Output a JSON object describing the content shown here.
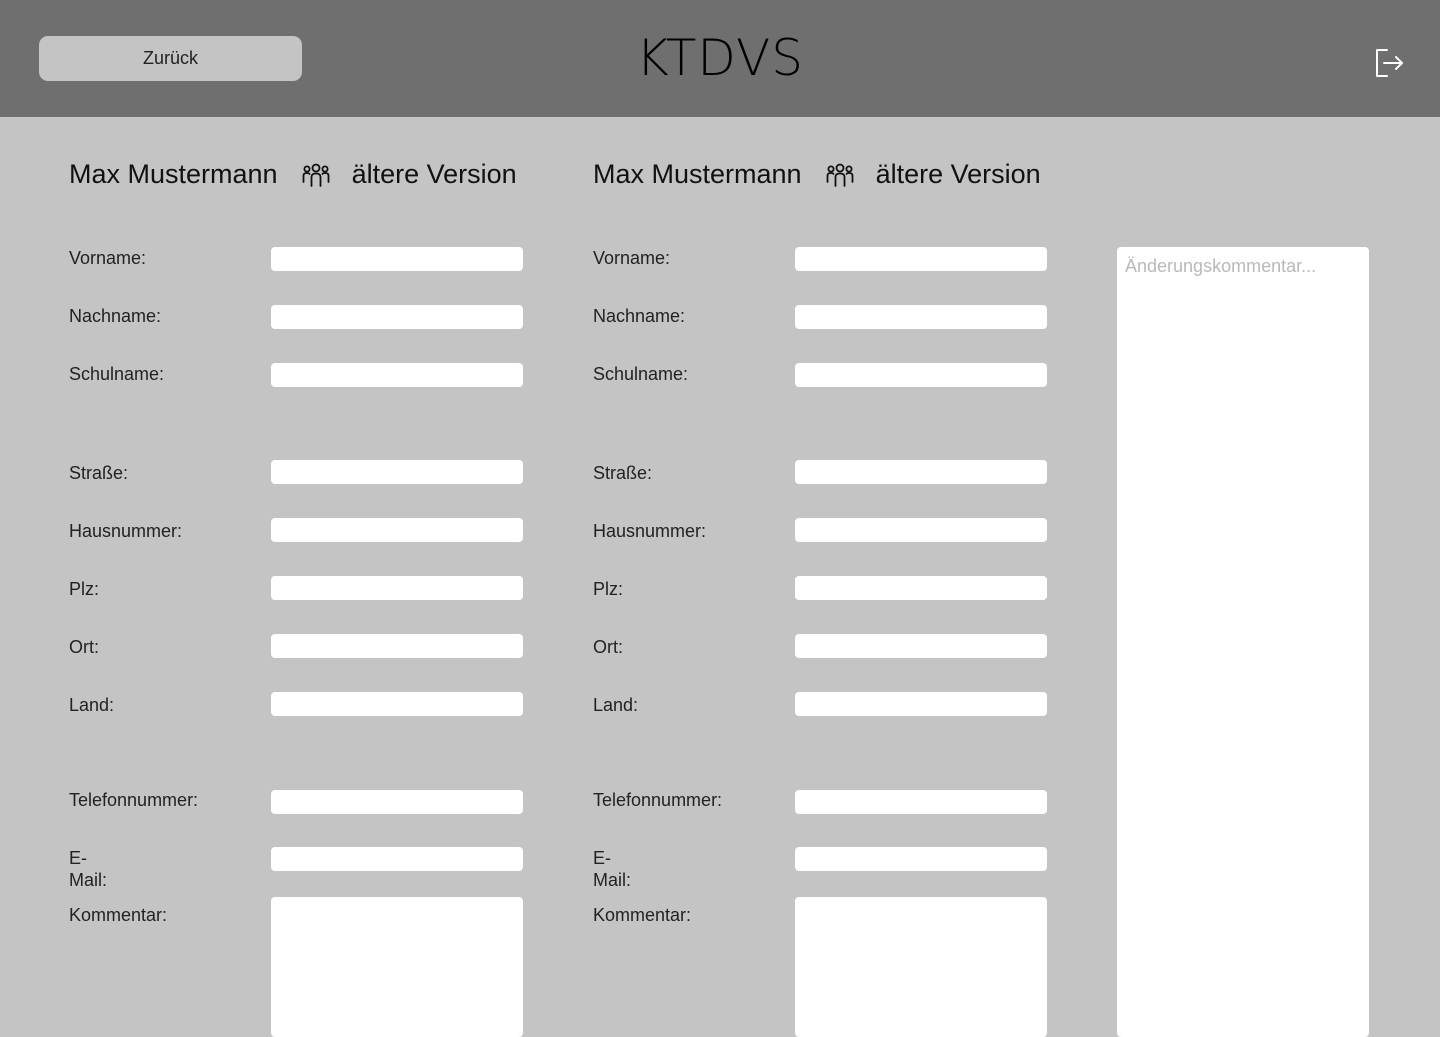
{
  "header": {
    "back_label": "Zurück",
    "title": "KTDVS",
    "logout_icon": "logout-icon"
  },
  "columns": [
    {
      "name": "Max Mustermann",
      "icon": "group-icon",
      "version_label": "ältere Version",
      "fields": {
        "vorname": {
          "label": "Vorname:",
          "value": ""
        },
        "nachname": {
          "label": "Nachname:",
          "value": ""
        },
        "schulname": {
          "label": "Schulname:",
          "value": ""
        },
        "strasse": {
          "label": "Straße:",
          "value": ""
        },
        "hausnummer": {
          "label": "Hausnummer:",
          "value": ""
        },
        "plz": {
          "label": "Plz:",
          "value": ""
        },
        "ort": {
          "label": "Ort:",
          "value": ""
        },
        "land": {
          "label": "Land:",
          "value": ""
        },
        "telefonnummer": {
          "label": "Telefonnummer:",
          "value": ""
        },
        "email": {
          "label": "E-Mail:",
          "value": ""
        },
        "kommentar": {
          "label": "Kommentar:",
          "value": ""
        }
      }
    },
    {
      "name": "Max Mustermann",
      "icon": "group-icon",
      "version_label": "ältere Version",
      "fields": {
        "vorname": {
          "label": "Vorname:",
          "value": ""
        },
        "nachname": {
          "label": "Nachname:",
          "value": ""
        },
        "schulname": {
          "label": "Schulname:",
          "value": ""
        },
        "strasse": {
          "label": "Straße:",
          "value": ""
        },
        "hausnummer": {
          "label": "Hausnummer:",
          "value": ""
        },
        "plz": {
          "label": "Plz:",
          "value": ""
        },
        "ort": {
          "label": "Ort:",
          "value": ""
        },
        "land": {
          "label": "Land:",
          "value": ""
        },
        "telefonnummer": {
          "label": "Telefonnummer:",
          "value": ""
        },
        "email": {
          "label": "E-Mail:",
          "value": ""
        },
        "kommentar": {
          "label": "Kommentar:",
          "value": ""
        }
      }
    }
  ],
  "change_comment": {
    "placeholder": "Änderungskommentar...",
    "value": ""
  },
  "colors": {
    "header_bg": "#6f6f6f",
    "page_bg": "#c4c4c4",
    "field_bg": "#ffffff"
  }
}
